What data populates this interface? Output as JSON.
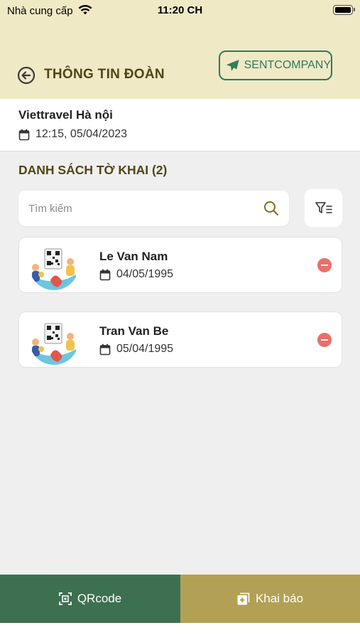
{
  "status_bar": {
    "carrier": "Nhà cung cấp",
    "time": "11:20 CH"
  },
  "header": {
    "title": "THÔNG TIN ĐOÀN",
    "sent_button": "SENTCOMPANY"
  },
  "group": {
    "name": "Viettravel Hà nội",
    "datetime": "12:15, 05/04/2023"
  },
  "list": {
    "title": "DANH SÁCH TỜ KHAI (2)",
    "search_placeholder": "Tìm kiếm",
    "items": [
      {
        "name": "Le Van Nam",
        "date": "04/05/1995"
      },
      {
        "name": "Tran Van Be",
        "date": "05/04/1995"
      }
    ]
  },
  "bottom": {
    "qr_label": "QRcode",
    "declare_label": "Khai báo"
  },
  "colors": {
    "header_bg": "#efe9c6",
    "title": "#4f4517",
    "green": "#3d7050",
    "gold": "#b2a054",
    "remove": "#ea6f6a"
  },
  "icons": [
    "wifi-icon",
    "battery-icon",
    "back-arrow-icon",
    "send-icon",
    "calendar-icon",
    "search-icon",
    "filter-icon",
    "qr-scan-icon",
    "add-photo-icon",
    "remove-icon"
  ]
}
